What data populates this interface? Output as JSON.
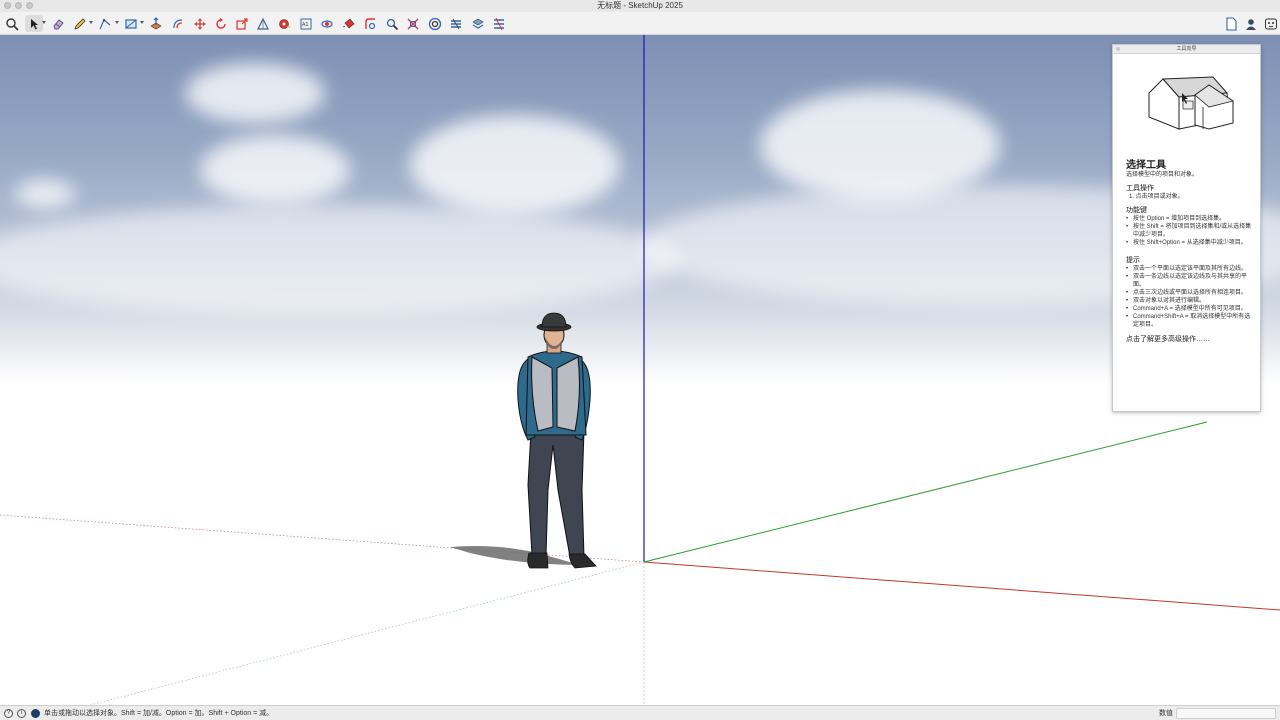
{
  "window": {
    "title": "无标题 - SketchUp 2025"
  },
  "toolbar": {
    "left_tools": [
      "search-icon",
      "select-arrow-icon",
      "eraser-icon",
      "pencil-icon",
      "line-icon",
      "rectangle-icon",
      "push-pull-icon",
      "offset-icon",
      "move-icon",
      "rotate-icon",
      "scale-icon",
      "protractor-icon",
      "tape-measure-icon",
      "dimension-icon",
      "orbit-icon",
      "paint-bucket-icon",
      "follow-me-icon",
      "zoom-icon",
      "zoom-extents-icon",
      "section-plane-icon",
      "layers-icon",
      "styles-icon",
      "scenes-icon"
    ],
    "right_tools": [
      "document-icon",
      "account-icon",
      "help-icon"
    ]
  },
  "instructor": {
    "header": "工具向导",
    "title": "选择工具",
    "subtitle": "选择模型中的项目和对象。",
    "operation_heading": "工具操作",
    "operation_step": "1. 点击项目或对象。",
    "modifier_heading": "功能键",
    "modifiers": [
      "按住 Option = 增加项目到选择集。",
      "按住 Shift = 将加项目到选择集和/或从选择集中减少项目。",
      "按住 Shift+Option = 从选择集中减少项目。"
    ],
    "tips_heading": "提示",
    "tips": [
      "双击一个平面以选定该平面及其所有边线。",
      "双击一条边线以选定该边线及与其共享的平面。",
      "点击三次边线或平面以选择所有相连项目。",
      "双击对象以对其进行编辑。",
      "Command+A = 选择模型中所有可见项目。",
      "Command+Shift+A = 取消选择模型中所有选定项目。"
    ],
    "more_link": "点击了解更多高级操作……"
  },
  "status": {
    "text": "单击或拖动以选择对象。Shift = 加/减。Option = 加。Shift + Option = 减。",
    "measure_label": "数值",
    "measure_value": ""
  },
  "colors": {
    "axis_blue": "#1a1aa8",
    "axis_red": "#c0392b",
    "axis_green": "#2e9b2e",
    "sky_top": "#7d90b4"
  }
}
